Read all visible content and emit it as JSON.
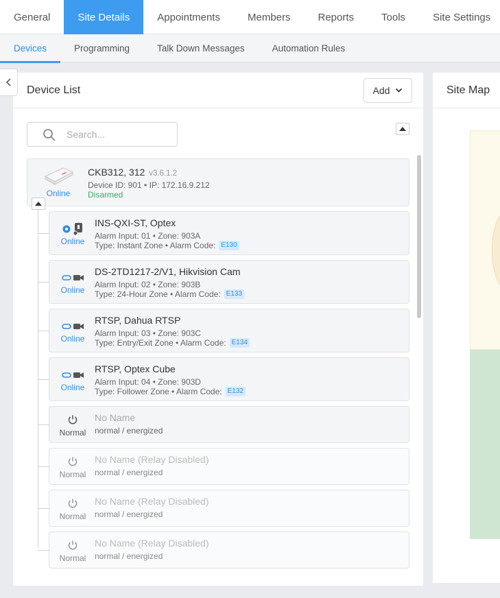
{
  "topnav": {
    "tabs": [
      {
        "label": "General"
      },
      {
        "label": "Site Details"
      },
      {
        "label": "Appointments"
      },
      {
        "label": "Members"
      },
      {
        "label": "Reports"
      },
      {
        "label": "Tools"
      },
      {
        "label": "Site Settings"
      }
    ],
    "active": "Site Details"
  },
  "subnav": {
    "tabs": [
      {
        "label": "Devices"
      },
      {
        "label": "Programming"
      },
      {
        "label": "Talk Down Messages"
      },
      {
        "label": "Automation Rules"
      }
    ],
    "active": "Devices"
  },
  "device_list": {
    "title": "Device List",
    "add_label": "Add",
    "search_placeholder": "Search...",
    "controller": {
      "name": "CKB312, 312",
      "version": "v3.6.1.2",
      "meta": "Device ID: 901 • IP: 172.16.9.212",
      "status": "Online",
      "arm_state": "Disarmed"
    },
    "devices": [
      {
        "title": "INS-QXI-ST, Optex",
        "line1": "Alarm Input: 01 • Zone: 903A",
        "line2": "Type: Instant Zone • Alarm Code:",
        "code": "E130",
        "status": "Online",
        "icon": "motion-sensor-icon"
      },
      {
        "title": "DS-2TD1217-2/V1, Hikvision Cam",
        "line1": "Alarm Input: 02 • Zone: 903B",
        "line2": "Type: 24-Hour Zone • Alarm Code:",
        "code": "E133",
        "status": "Online",
        "icon": "camera-icon"
      },
      {
        "title": "RTSP, Dahua RTSP",
        "line1": "Alarm Input: 03 • Zone: 903C",
        "line2": "Type: Entry/Exit Zone • Alarm Code:",
        "code": "E134",
        "status": "Online",
        "icon": "camera-icon"
      },
      {
        "title": "RTSP, Optex Cube",
        "line1": "Alarm Input: 04 • Zone: 903D",
        "line2": "Type: Follower Zone • Alarm Code:",
        "code": "E132",
        "status": "Online",
        "icon": "camera-icon"
      }
    ],
    "relays": [
      {
        "title": "No Name",
        "line1": "normal / energized",
        "status": "Normal"
      },
      {
        "title": "No Name (Relay Disabled)",
        "line1": "normal / energized",
        "status": "Normal"
      },
      {
        "title": "No Name (Relay Disabled)",
        "line1": "normal / energized",
        "status": "Normal"
      },
      {
        "title": "No Name (Relay Disabled)",
        "line1": "normal / energized",
        "status": "Normal"
      }
    ]
  },
  "site_map": {
    "title": "Site Map"
  },
  "colors": {
    "accent": "#3d9bf0",
    "online": "#2f8fe6",
    "disarmed": "#3aa86b"
  }
}
